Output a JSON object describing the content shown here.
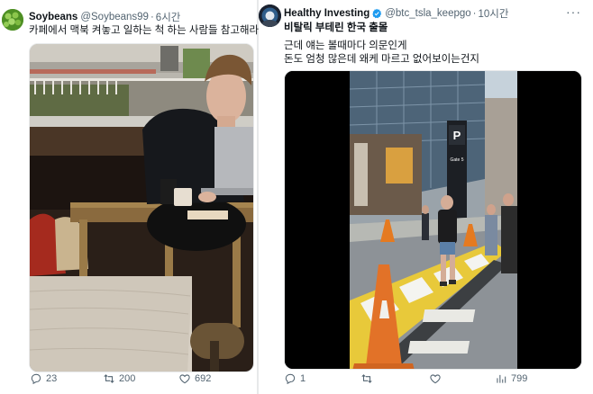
{
  "left_tweet": {
    "author_name": "Soybeans",
    "handle": "@Soybeans99",
    "separator": "·",
    "time": "6시간",
    "text": "카페에서 맥북 켜놓고 일하는 척 하는 사람들 참고해라",
    "replies": "23",
    "retweets": "200",
    "likes": "692"
  },
  "right_tweet": {
    "author_name": "Healthy Investing",
    "handle": "@btc_tsla_keepgo",
    "separator": "·",
    "time": "10시간",
    "more": "···",
    "subtitle": "비탈릭 부테린 한국 출몰",
    "body_line1": "근데 얘는 볼때마다 의문인게",
    "body_line2": "돈도 엄청 많은데 왜케 마르고 없어보이는건지",
    "replies": "1",
    "views": "799",
    "sign_letter": "P",
    "sign_text": "Gate 5"
  },
  "colors": {
    "text_primary": "#0f1419",
    "text_secondary": "#536471",
    "verified_blue": "#1d9bf0",
    "divider": "#e7e9ea"
  },
  "icons": [
    "reply-icon",
    "retweet-icon",
    "like-icon",
    "views-icon",
    "verified-badge-icon",
    "more-icon"
  ]
}
